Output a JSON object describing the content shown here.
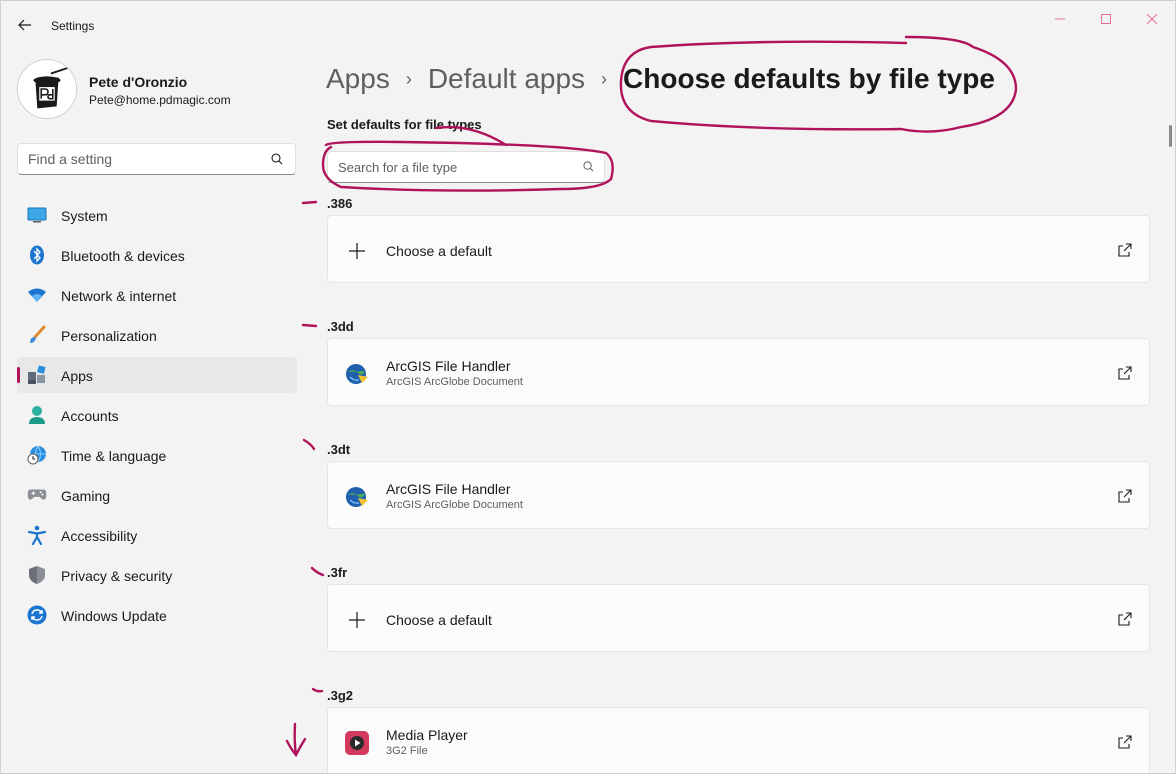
{
  "window": {
    "title": "Settings"
  },
  "profile": {
    "name": "Pete d'Oronzio",
    "email": "Pete@home.pdmagic.com"
  },
  "search": {
    "placeholder": "Find a setting"
  },
  "nav": [
    {
      "label": "System",
      "icon": "monitor-icon"
    },
    {
      "label": "Bluetooth & devices",
      "icon": "bluetooth-icon"
    },
    {
      "label": "Network & internet",
      "icon": "wifi-icon"
    },
    {
      "label": "Personalization",
      "icon": "brush-icon"
    },
    {
      "label": "Apps",
      "icon": "apps-icon",
      "active": true
    },
    {
      "label": "Accounts",
      "icon": "person-icon"
    },
    {
      "label": "Time & language",
      "icon": "globe-clock-icon"
    },
    {
      "label": "Gaming",
      "icon": "gamepad-icon"
    },
    {
      "label": "Accessibility",
      "icon": "accessibility-icon"
    },
    {
      "label": "Privacy & security",
      "icon": "shield-icon"
    },
    {
      "label": "Windows Update",
      "icon": "update-icon"
    }
  ],
  "breadcrumb": {
    "items": [
      "Apps",
      "Default apps"
    ],
    "current": "Choose defaults by file type"
  },
  "section": {
    "label": "Set defaults for file types"
  },
  "filetype_search": {
    "placeholder": "Search for a file type"
  },
  "file_types": [
    {
      "ext": ".386",
      "title": "Choose a default",
      "subtitle": "",
      "icon": "plus-icon"
    },
    {
      "ext": ".3dd",
      "title": "ArcGIS File Handler",
      "subtitle": "ArcGIS ArcGlobe Document",
      "icon": "arcgis-icon"
    },
    {
      "ext": ".3dt",
      "title": "ArcGIS File Handler",
      "subtitle": "ArcGIS ArcGlobe Document",
      "icon": "arcgis-icon"
    },
    {
      "ext": ".3fr",
      "title": "Choose a default",
      "subtitle": "",
      "icon": "plus-icon"
    },
    {
      "ext": ".3g2",
      "title": "Media Player",
      "subtitle": "3G2 File",
      "icon": "media-player-icon"
    }
  ],
  "colors": {
    "accent": "#b0125b",
    "ink": "#b0125b"
  }
}
